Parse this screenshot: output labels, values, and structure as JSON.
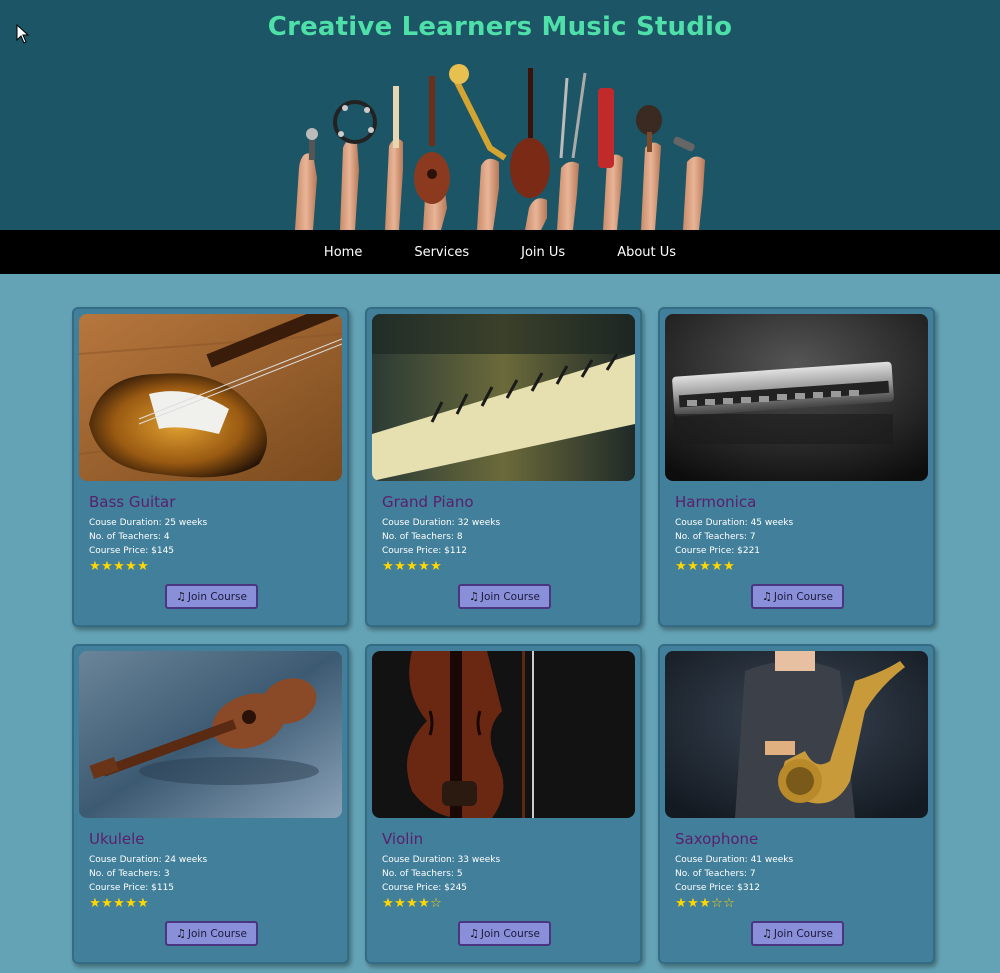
{
  "site": {
    "title": "Creative Learners Music Studio"
  },
  "nav": {
    "items": [
      "Home",
      "Services",
      "Join Us",
      "About Us"
    ]
  },
  "courses": [
    {
      "name": "Bass Guitar",
      "duration": "Couse Duration: 25 weeks",
      "teachers": "No. of Teachers: 4",
      "price": "Course Price: $145",
      "rating": 5,
      "button": "Join Course",
      "image": "bass-guitar"
    },
    {
      "name": "Grand Piano",
      "duration": "Couse Duration: 32 weeks",
      "teachers": "No. of Teachers: 8",
      "price": "Course Price: $112",
      "rating": 5,
      "button": "Join Course",
      "image": "grand-piano"
    },
    {
      "name": "Harmonica",
      "duration": "Couse Duration: 45 weeks",
      "teachers": "No. of Teachers: 7",
      "price": "Course Price: $221",
      "rating": 5,
      "button": "Join Course",
      "image": "harmonica"
    },
    {
      "name": "Ukulele",
      "duration": "Couse Duration: 24 weeks",
      "teachers": "No. of Teachers: 3",
      "price": "Course Price: $115",
      "rating": 5,
      "button": "Join Course",
      "image": "ukulele"
    },
    {
      "name": "Violin",
      "duration": "Couse Duration: 33 weeks",
      "teachers": "No. of Teachers: 5",
      "price": "Course Price: $245",
      "rating": 4,
      "button": "Join Course",
      "image": "violin"
    },
    {
      "name": "Saxophone",
      "duration": "Couse Duration: 41 weeks",
      "teachers": "No. of Teachers: 7",
      "price": "Course Price: $312",
      "rating": 3,
      "button": "Join Course",
      "image": "saxophone"
    }
  ],
  "icons": {
    "button": "music-note-icon",
    "star": "star-icon",
    "cursor": "mouse-cursor-icon"
  },
  "colors": {
    "title": "#4fdfa8",
    "course_title": "#5a1f6e",
    "star": "#ffd700",
    "button": "#8a8fd9"
  }
}
